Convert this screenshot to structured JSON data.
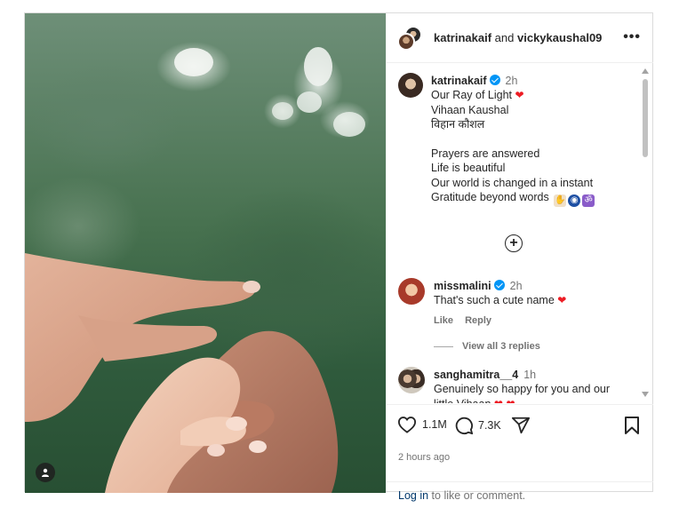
{
  "header": {
    "user1": "katrinakaif",
    "joiner": "and",
    "user2": "vickykaushal09"
  },
  "caption": {
    "username": "katrinakaif",
    "time": "2h",
    "lines": [
      "Our Ray of Light",
      "Vihaan Kaushal",
      "विहान कौशल",
      "",
      "Prayers are answered",
      "Life is beautiful",
      "Our world is changed in a instant",
      "Gratitude beyond words"
    ]
  },
  "comments": [
    {
      "username": "missmalini",
      "verified": true,
      "time": "2h",
      "text": "That's such a cute name",
      "like_label": "Like",
      "reply_label": "Reply",
      "view_replies": "View all 3 replies"
    },
    {
      "username": "sanghamitra__4",
      "time": "1h",
      "text": "Genuinely so happy for you and our little Vihaan"
    }
  ],
  "actions": {
    "likes": "1.1M",
    "comments": "7.3K",
    "posted_ago": "2 hours ago"
  },
  "footer": {
    "login_link": "Log in",
    "login_rest": "to like or comment."
  },
  "colors": {
    "verified_blue": "#0095f6",
    "heart_red": "#ed1c24",
    "link_dark_blue": "#00376b"
  },
  "icons": [
    "more-icon",
    "verified-icon",
    "heart-icon",
    "comment-icon",
    "share-icon",
    "bookmark-icon",
    "add-circle-icon",
    "user-tag-icon"
  ]
}
